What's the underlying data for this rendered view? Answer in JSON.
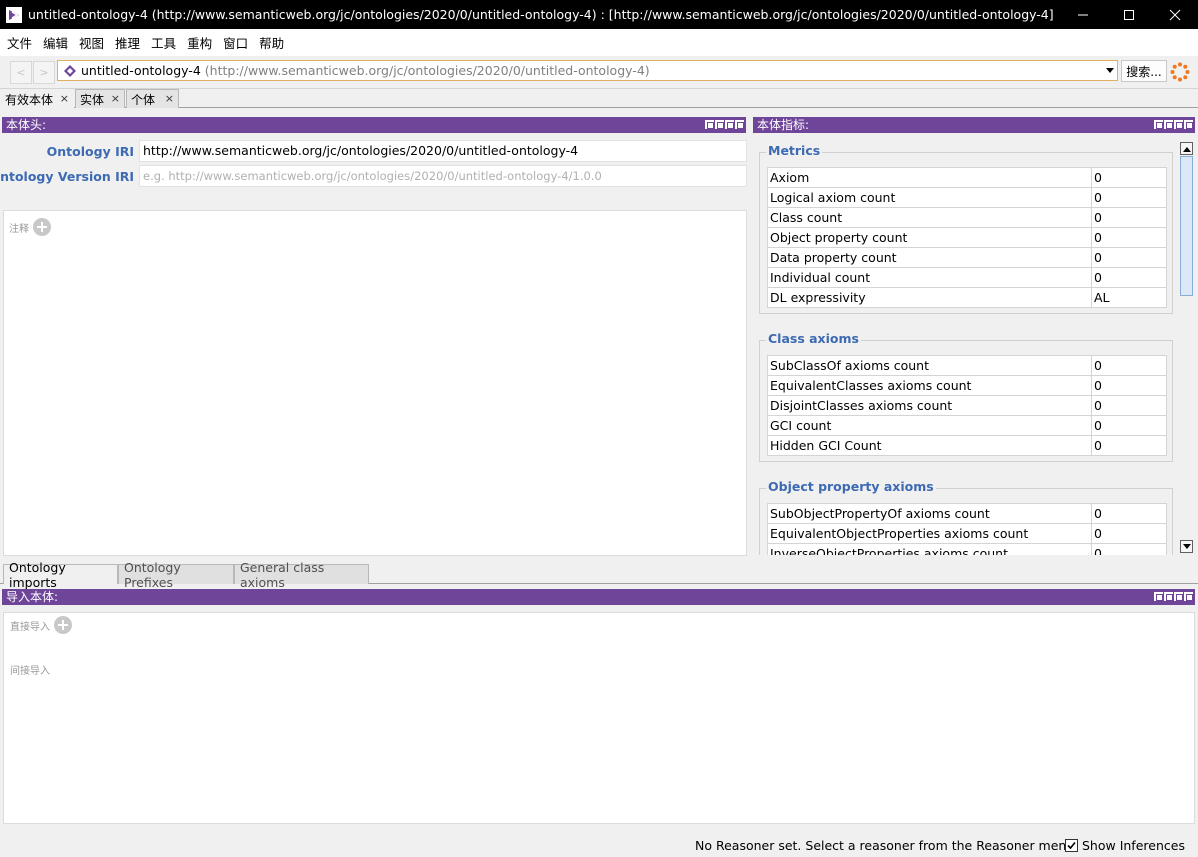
{
  "window": {
    "title": "untitled-ontology-4 (http://www.semanticweb.org/jc/ontologies/2020/0/untitled-ontology-4)  : [http://www.semanticweb.org/jc/ontologies/2020/0/untitled-ontology-4]"
  },
  "menu": [
    "文件",
    "编辑",
    "视图",
    "推理",
    "工具",
    "重构",
    "窗口",
    "帮助"
  ],
  "toolbar": {
    "back": "<",
    "forward": ">",
    "ontology_name": "untitled-ontology-4",
    "ontology_iri": "(http://www.semanticweb.org/jc/ontologies/2020/0/untitled-ontology-4)",
    "search_label": "搜索..."
  },
  "tabs": [
    {
      "label": "有效本体",
      "close": "×"
    },
    {
      "label": "实体",
      "close": "×"
    },
    {
      "label": "个体",
      "close": "×"
    }
  ],
  "header_panel": {
    "title": "本体头:",
    "iri_label": "Ontology IRI",
    "iri_value": "http://www.semanticweb.org/jc/ontologies/2020/0/untitled-ontology-4",
    "version_label": "Ontology Version IRI",
    "version_placeholder": "e.g. http://www.semanticweb.org/jc/ontologies/2020/0/untitled-ontology-4/1.0.0",
    "annotations_label": "注释"
  },
  "metrics_panel": {
    "title": "本体指标:",
    "groups": [
      {
        "title": "Metrics",
        "rows": [
          {
            "name": "Axiom",
            "value": "0"
          },
          {
            "name": "Logical axiom count",
            "value": "0"
          },
          {
            "name": "Class count",
            "value": "0"
          },
          {
            "name": "Object property count",
            "value": "0"
          },
          {
            "name": "Data property count",
            "value": "0"
          },
          {
            "name": "Individual count",
            "value": "0"
          },
          {
            "name": "DL expressivity",
            "value": "AL"
          }
        ]
      },
      {
        "title": "Class axioms",
        "rows": [
          {
            "name": "SubClassOf axioms count",
            "value": "0"
          },
          {
            "name": "EquivalentClasses axioms count",
            "value": "0"
          },
          {
            "name": "DisjointClasses axioms count",
            "value": "0"
          },
          {
            "name": "GCI count",
            "value": "0"
          },
          {
            "name": "Hidden GCI Count",
            "value": "0"
          }
        ]
      },
      {
        "title": "Object property axioms",
        "rows": [
          {
            "name": "SubObjectPropertyOf axioms count",
            "value": "0"
          },
          {
            "name": "EquivalentObjectProperties axioms count",
            "value": "0"
          },
          {
            "name": "InverseObjectProperties axioms count",
            "value": "0"
          }
        ]
      }
    ]
  },
  "bottom_tabs": [
    "Ontology imports",
    "Ontology Prefixes",
    "General class axioms"
  ],
  "imports_panel": {
    "title": "导入本体:",
    "direct_label": "直接导入",
    "indirect_label": "间接导入"
  },
  "status": {
    "message": "No Reasoner set. Select a reasoner from the Reasoner menu",
    "show_inferences_label": "Show Inferences",
    "show_inferences_checked": true
  },
  "colors": {
    "panel_header": "#6f459a",
    "label_blue": "#3d6ab2"
  }
}
